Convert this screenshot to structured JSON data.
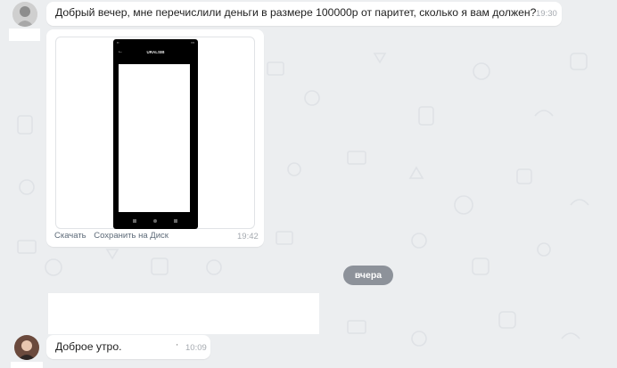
{
  "messages": {
    "first": {
      "text": "Добрый вечер, мне перечислили деньги в размере 100000р от паритет, сколько я вам должен?",
      "time": "19:30"
    },
    "image_message": {
      "phone_header": "URALSIB",
      "download_label": "Скачать",
      "save_to_disk_label": "Сохранить на Диск",
      "time": "19:42"
    },
    "date_separator": "вчера",
    "reply": {
      "text": "Доброе утро.",
      "time": "10:09"
    }
  },
  "colors": {
    "background": "#eceef0",
    "bubble": "#ffffff",
    "date_pill": "#8d929a",
    "link": "#5d6a78",
    "time": "#a5aab0"
  }
}
